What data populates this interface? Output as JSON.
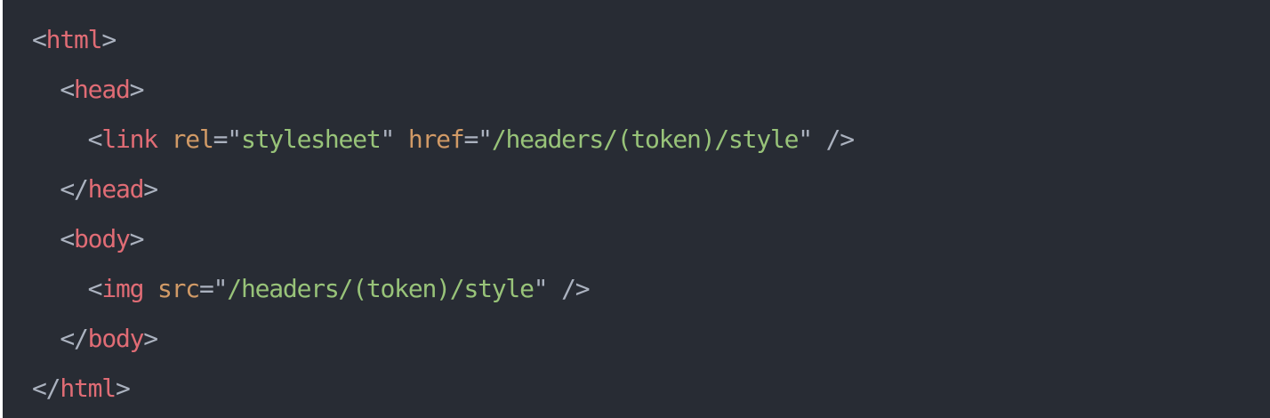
{
  "code_block": {
    "language": "html",
    "colors": {
      "background": "#282c34",
      "punctuation": "#abb2bf",
      "tag": "#e06c75",
      "attribute": "#d19a66",
      "string": "#98c379"
    },
    "lines": [
      {
        "indent": "",
        "open": "<",
        "tag": "html",
        "close": ">"
      },
      {
        "indent": "  ",
        "open": "<",
        "tag": "head",
        "close": ">"
      },
      {
        "indent": "    ",
        "open": "<",
        "tag": "link",
        "attr1_name": "rel",
        "attr1_eq": "=\"",
        "attr1_value": "stylesheet",
        "attr1_end": "\"",
        "attr2_name": "href",
        "attr2_eq": "=\"",
        "attr2_value": "/headers/(token)/style",
        "attr2_end": "\"",
        "close": " />"
      },
      {
        "indent": "  ",
        "open": "</",
        "tag": "head",
        "close": ">"
      },
      {
        "indent": "  ",
        "open": "<",
        "tag": "body",
        "close": ">"
      },
      {
        "indent": "    ",
        "open": "<",
        "tag": "img",
        "attr1_name": "src",
        "attr1_eq": "=\"",
        "attr1_value": "/headers/(token)/style",
        "attr1_end": "\"",
        "close": " />"
      },
      {
        "indent": "  ",
        "open": "</",
        "tag": "body",
        "close": ">"
      },
      {
        "indent": "",
        "open": "</",
        "tag": "html",
        "close": ">"
      }
    ]
  }
}
